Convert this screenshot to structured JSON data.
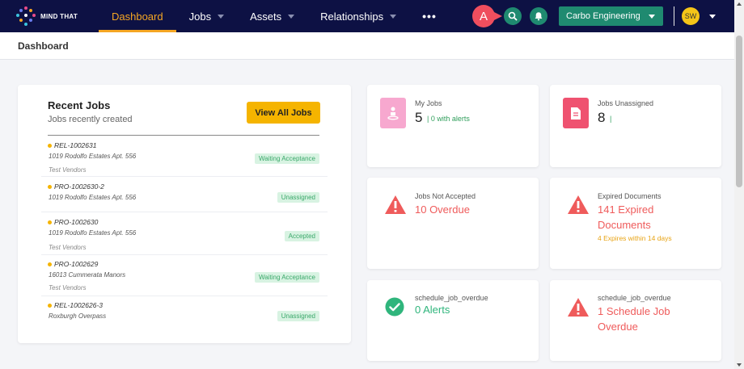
{
  "app": {
    "logo_text": "MIND THAT"
  },
  "nav": {
    "items": [
      {
        "label": "Dashboard"
      },
      {
        "label": "Jobs"
      },
      {
        "label": "Assets"
      },
      {
        "label": "Relationships"
      },
      {
        "label": "•••"
      }
    ]
  },
  "header": {
    "avatar_letter": "A",
    "organization": "Carbo Engineering",
    "user_initials": "SW"
  },
  "breadcrumb": {
    "title": "Dashboard"
  },
  "recent_jobs": {
    "title": "Recent Jobs",
    "subtitle": "Jobs recently created",
    "view_all_label": "View All Jobs",
    "jobs": [
      {
        "id": "REL-1002631",
        "address": "1019 Rodolfo Estates Apt. 556",
        "vendor": "Test Vendors",
        "status": "Waiting Acceptance"
      },
      {
        "id": "PRO-1002630-2",
        "address": "1019 Rodolfo Estates Apt. 556",
        "vendor": "",
        "status": "Unassigned"
      },
      {
        "id": "PRO-1002630",
        "address": "1019 Rodolfo Estates Apt. 556",
        "vendor": "Test Vendors",
        "status": "Accepted"
      },
      {
        "id": "PRO-1002629",
        "address": "16013 Cummerata Manors",
        "vendor": "Test Vendors",
        "status": "Waiting Acceptance"
      },
      {
        "id": "REL-1002626-3",
        "address": "Roxburgh Overpass",
        "vendor": "",
        "status": "Unassigned"
      }
    ]
  },
  "stats": {
    "my_jobs": {
      "label": "My Jobs",
      "count": "5",
      "alerts": "| 0 with alerts"
    },
    "jobs_unassigned": {
      "label": "Jobs Unassigned",
      "count": "8",
      "alerts": "|"
    },
    "jobs_not_accepted": {
      "label": "Jobs Not Accepted",
      "value": "10 Overdue"
    },
    "expired_documents": {
      "label": "Expired Documents",
      "value_line1": "141 Expired",
      "value_line2": "Documents",
      "sub": "4 Expires within 14 days"
    },
    "schedule_overdue_alerts": {
      "label": "schedule_job_overdue",
      "value": "0 Alerts"
    },
    "schedule_overdue_jobs": {
      "label": "schedule_job_overdue",
      "value_line1": "1 Schedule Job",
      "value_line2": "Overdue"
    }
  },
  "colors": {
    "nav_bg": "#0d1144",
    "accent_orange": "#f5a623",
    "teal": "#1f8a70",
    "red": "#ef5b5b",
    "green": "#2fb57c"
  }
}
